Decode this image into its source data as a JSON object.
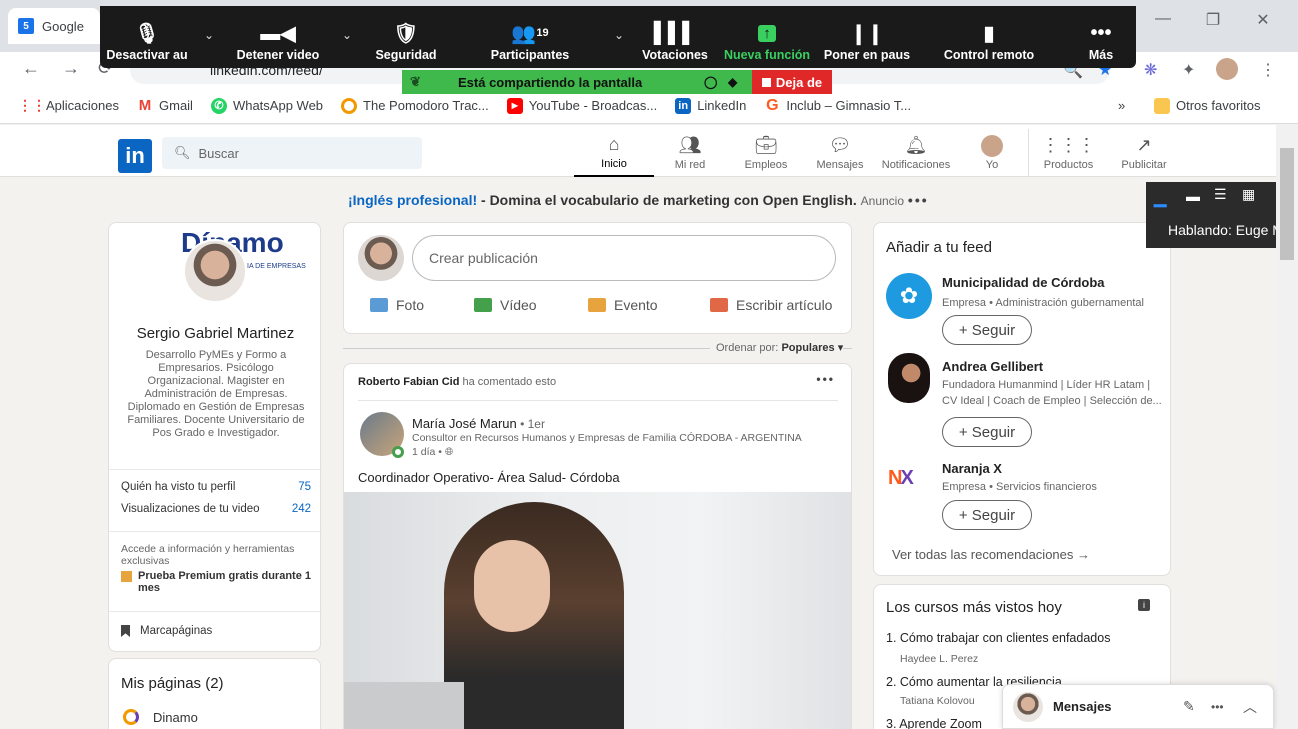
{
  "browser": {
    "tab_title": "Google",
    "url": "linkedin.com/feed/",
    "bookmarks": [
      {
        "label": "Aplicaciones"
      },
      {
        "label": "Gmail"
      },
      {
        "label": "WhatsApp Web"
      },
      {
        "label": "The Pomodoro Trac..."
      },
      {
        "label": "YouTube - Broadcas..."
      },
      {
        "label": "LinkedIn"
      },
      {
        "label": "Inclub – Gimnasio T..."
      }
    ],
    "more_bookmarks": "»",
    "other_bookmarks": "Otros favoritos"
  },
  "zoom": {
    "mute_label": "Desactivar au",
    "video_label": "Detener video",
    "security_label": "Seguridad",
    "participants_label": "Participantes",
    "participants_count": "19",
    "polls_label": "Votaciones",
    "new_feature_label": "Nueva función",
    "pause_label": "Poner en paus",
    "remote_label": "Control remoto",
    "more_label": "Más",
    "sharing_text": "Está compartiendo la pantalla",
    "stop_label": "Deja de",
    "speaking_text": "Hablando: Euge Mo"
  },
  "linkedin": {
    "search_placeholder": "Buscar",
    "nav": [
      {
        "label": "Inicio"
      },
      {
        "label": "Mi red"
      },
      {
        "label": "Empleos"
      },
      {
        "label": "Mensajes"
      },
      {
        "label": "Notificaciones"
      },
      {
        "label": "Yo"
      },
      {
        "label": "Productos"
      },
      {
        "label": "Publicitar"
      }
    ],
    "ad": {
      "highlight": "¡Inglés profesional!",
      "text": " - Domina el vocabulario de marketing con Open English.",
      "tag": "Anuncio"
    },
    "profile": {
      "brand": "Dínamo",
      "brand_sub": "IA DE EMPRESAS",
      "name": "Sergio Gabriel Martinez",
      "headline": "Desarrollo PyMEs y Formo a Empresarios. Psicólogo Organizacional. Magister en Administración de Empresas. Diplomado en Gestión de Empresas Familiares. Docente Universitario de Pos Grado e Investigador.",
      "stats": [
        {
          "label": "Quién ha visto tu perfil",
          "value": "75"
        },
        {
          "label": "Visualizaciones de tu video",
          "value": "242"
        }
      ],
      "premium_text": "Accede a información y herramientas exclusivas",
      "premium_cta": "Prueba Premium gratis durante 1 mes",
      "bookmarks": "Marcapáginas"
    },
    "pages": {
      "title": "Mis páginas (2)",
      "first": "Dinamo"
    },
    "composer": {
      "placeholder": "Crear publicación",
      "photo": "Foto",
      "video": "Vídeo",
      "event": "Evento",
      "article": "Escribir artículo"
    },
    "sort": {
      "label": "Ordenar por:",
      "value": "Populares"
    },
    "post": {
      "actor": "Roberto Fabian Cid",
      "action": " ha comentado esto",
      "author": "María José Marun",
      "degree": " • 1er",
      "author_title": "Consultor en Recursos Humanos y Empresas de Familia CÓRDOBA - ARGENTINA",
      "time": "1 día •",
      "text": "Coordinador Operativo- Área Salud- Córdoba"
    },
    "feed_suggestions": {
      "title": "Añadir a tu feed",
      "items": [
        {
          "name": "Municipalidad de Córdoba",
          "sub": "Empresa • Administración gubernamental",
          "follow": "+ Seguir"
        },
        {
          "name": "Andrea Gellibert",
          "sub": "Fundadora Humanmind | Líder HR Latam | CV Ideal | Coach de Empleo | Selección de...",
          "follow": "+ Seguir"
        },
        {
          "name": "Naranja X",
          "sub": "Empresa • Servicios financieros",
          "follow": "+ Seguir"
        }
      ],
      "see_all": "Ver todas las recomendaciones →"
    },
    "courses": {
      "title": "Los cursos más vistos hoy",
      "items": [
        {
          "title": "1. Cómo trabajar con clientes enfadados",
          "author": "Haydee L. Perez"
        },
        {
          "title": "2. Cómo aumentar la resiliencia",
          "author": "Tatiana Kolovou"
        },
        {
          "title": "3. Aprende Zoom",
          "author": ""
        }
      ]
    },
    "messaging": {
      "label": "Mensajes"
    }
  }
}
